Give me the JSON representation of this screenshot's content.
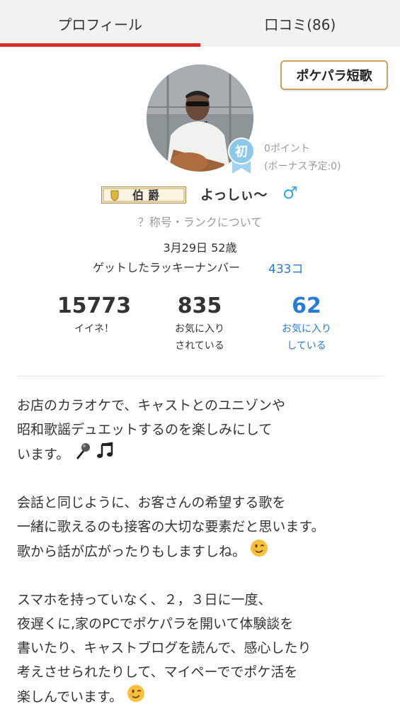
{
  "tabs": [
    {
      "label": "プロフィール",
      "active": true
    },
    {
      "label": "口コミ(86)",
      "active": false
    }
  ],
  "tanka_button": "ポケパラ短歌",
  "rank_badge": "初",
  "points": {
    "value": "0ポイント",
    "bonus": "(ボーナス予定:0)"
  },
  "title_badge": "伯爵",
  "username": "よっしぃ〜",
  "gender_symbol": "♂",
  "rank_link": "？称号・ランクについて",
  "birthday": "3月29日 52歳",
  "lucky": {
    "label": "ゲットしたラッキーナンバー",
    "value": "433コ"
  },
  "stats": [
    {
      "value": "15773",
      "label_line1": "イイネ！",
      "label_line2": ""
    },
    {
      "value": "835",
      "label_line1": "お気に入り",
      "label_line2": "されている"
    },
    {
      "value": "62",
      "label_line1": "お気に入り",
      "label_line2": "している"
    }
  ],
  "bio": [
    [
      "お店のカラオケで、キャストとのユニゾンや",
      "昭和歌謡デュエットするのを楽しみにして",
      "います。"
    ],
    [
      "会話と同じように、お客さんの希望する歌を",
      "一緒に歌えるのも接客の大切な要素だと思います。",
      "歌から話が広がったりもしますしね。"
    ],
    [
      "スマホを持っていなく、２，３日に一度、",
      "夜遅くに,家のPCでポケパラを開いて体験談を",
      "書いたり、キャストブログを読んで、感心したり",
      "考えさせられたりして、マイペーででポケ活を",
      "楽しんでいます。"
    ]
  ],
  "colors": {
    "accent": "#d92b2b",
    "link": "#2a7bd1",
    "gold": "#c8a25f",
    "gender": "#3aa6de"
  },
  "icons": {
    "mic": "microphone-emoji",
    "music": "music-notes-emoji",
    "wink": "winking-face-emoji"
  }
}
